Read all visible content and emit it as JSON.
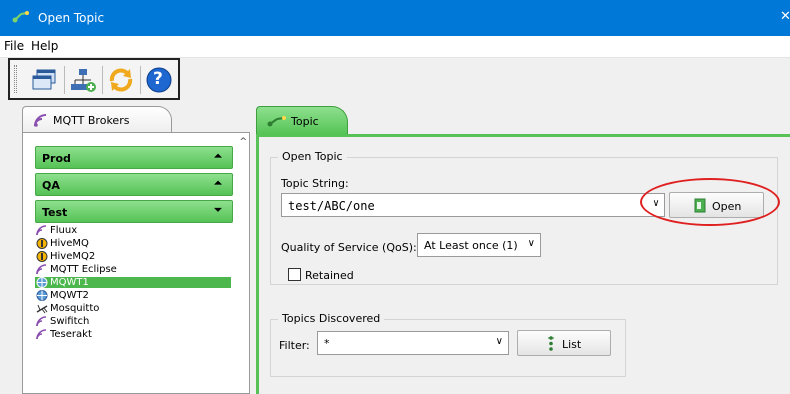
{
  "window": {
    "title": "Open Topic",
    "close_glyph": "✕"
  },
  "menu": {
    "file": "File",
    "help": "Help"
  },
  "toolbar": {
    "icons": [
      "windows-icon",
      "network-add-icon",
      "refresh-icon",
      "help-icon"
    ],
    "help_glyph": "?"
  },
  "brokers": {
    "tab_label": "MQTT Brokers",
    "groups": [
      {
        "label": "Prod",
        "state": "collapsed",
        "chevron": "⏶"
      },
      {
        "label": "QA",
        "state": "collapsed",
        "chevron": "⏶"
      },
      {
        "label": "Test",
        "state": "expanded",
        "chevron": "⏷"
      }
    ],
    "items": [
      {
        "label": "Fluux",
        "icon": "signal-icon"
      },
      {
        "label": "HiveMQ",
        "icon": "hive-icon"
      },
      {
        "label": "HiveMQ2",
        "icon": "hive-icon"
      },
      {
        "label": "MQTT Eclipse",
        "icon": "signal-icon"
      },
      {
        "label": "MQWT1",
        "icon": "globe-icon",
        "selected": true
      },
      {
        "label": "MQWT2",
        "icon": "globe-icon"
      },
      {
        "label": "Mosquitto",
        "icon": "mosquito-icon"
      },
      {
        "label": "Swifitch",
        "icon": "signal-icon"
      },
      {
        "label": "Teserakt",
        "icon": "signal-icon"
      }
    ]
  },
  "topic": {
    "tab_label": "Topic",
    "open_topic_legend": "Open Topic",
    "topic_string_label": "Topic String:",
    "topic_string_value": "test/ABC/one",
    "open_button": "Open",
    "qos_label": "Quality of Service (QoS):",
    "qos_value": "At Least once (1)",
    "retained_label": "Retained",
    "retained_checked": false,
    "discovered_legend": "Topics Discovered",
    "filter_label": "Filter:",
    "filter_value": "*",
    "list_button": "List",
    "dropdown_glyph": "∨"
  },
  "colors": {
    "titlebar": "#0078d7",
    "accent_green": "#55c255",
    "highlight_red": "#e02020"
  }
}
